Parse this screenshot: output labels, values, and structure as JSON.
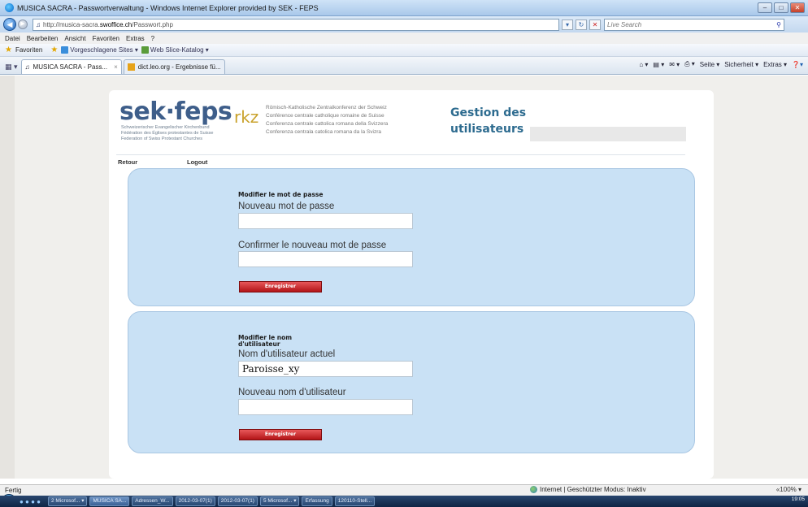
{
  "window": {
    "title": "MUSICA SACRA - Passwortverwaltung - Windows Internet Explorer provided by SEK - FEPS",
    "buttons": [
      "minimize",
      "maximize",
      "close"
    ]
  },
  "address": {
    "url_prefix": "http://musica-sacra.",
    "url_host": "swoffice.ch",
    "url_path": "/Passwort.php",
    "search_placeholder": "Live Search"
  },
  "menu": {
    "items": [
      "Datei",
      "Bearbeiten",
      "Ansicht",
      "Favoriten",
      "Extras",
      "?"
    ]
  },
  "favorites_bar": {
    "label": "Favoriten",
    "items": [
      "Vorgeschlagene Sites ▾",
      "Web Slice-Katalog ▾"
    ]
  },
  "tabs": {
    "items": [
      {
        "label": "MUSICA SACRA - Pass...",
        "close": "×"
      },
      {
        "label": "dict.leo.org - Ergebnisse fü..."
      }
    ],
    "commands": [
      "Seite ▾",
      "Sicherheit ▾",
      "Extras ▾"
    ]
  },
  "header": {
    "sek_logo": "sek·feps",
    "sek_sub": [
      "Schweizerischer Evangelischer Kirchenbund",
      "Fédération des Églises protestantes de Suisse",
      "Federation of Swiss Protestant Churches"
    ],
    "rkz_logo": "rkz",
    "rkz_lines": [
      "Römisch-Katholische Zentralkonferenz der Schweiz",
      "Conférence centrale catholique romaine de Suisse",
      "Conferenza centrale cattolica romana della Svizzera",
      "Conferenza centrala catolica romana da la Svizra"
    ],
    "title_line1": "Gestion des",
    "title_line2": "utilisateurs"
  },
  "nav": {
    "back": "Retour",
    "logout": "Logout"
  },
  "password_panel": {
    "title": "Modifier le mot de passe",
    "new_label": "Nouveau mot de passe",
    "new_value": "",
    "confirm_label": "Confirmer le nouveau mot de passe",
    "confirm_value": "",
    "save": "Enregistrer"
  },
  "username_panel": {
    "title_line1": "Modifier le nom",
    "title_line2": "d'utilisateur",
    "current_label": "Nom d'utilisateur actuel",
    "current_value": "Paroisse_xy",
    "new_label": "Nouveau nom d'utilisateur",
    "new_value": "",
    "save": "Enregistrer"
  },
  "status": {
    "left": "Fertig",
    "zone": "Internet | Geschützter Modus: Inaktiv",
    "zoom": "«100% ▾"
  },
  "taskbar": {
    "items": [
      "2 Microsof... ▾",
      "MUSICA SA...",
      "Adressen_W...",
      "2012-03-07(1)",
      "2012-03-07(1)",
      "5 Microsof... ▾",
      "Erfassung",
      "120110-Stell..."
    ],
    "clock": "19:05"
  },
  "colors": {
    "panel_bg": "#c9e1f5",
    "button_red": "#c0181c",
    "title_blue": "#2d6b8f",
    "logo_blue": "#3e5e8a",
    "rkz_gold": "#c9a22b"
  }
}
